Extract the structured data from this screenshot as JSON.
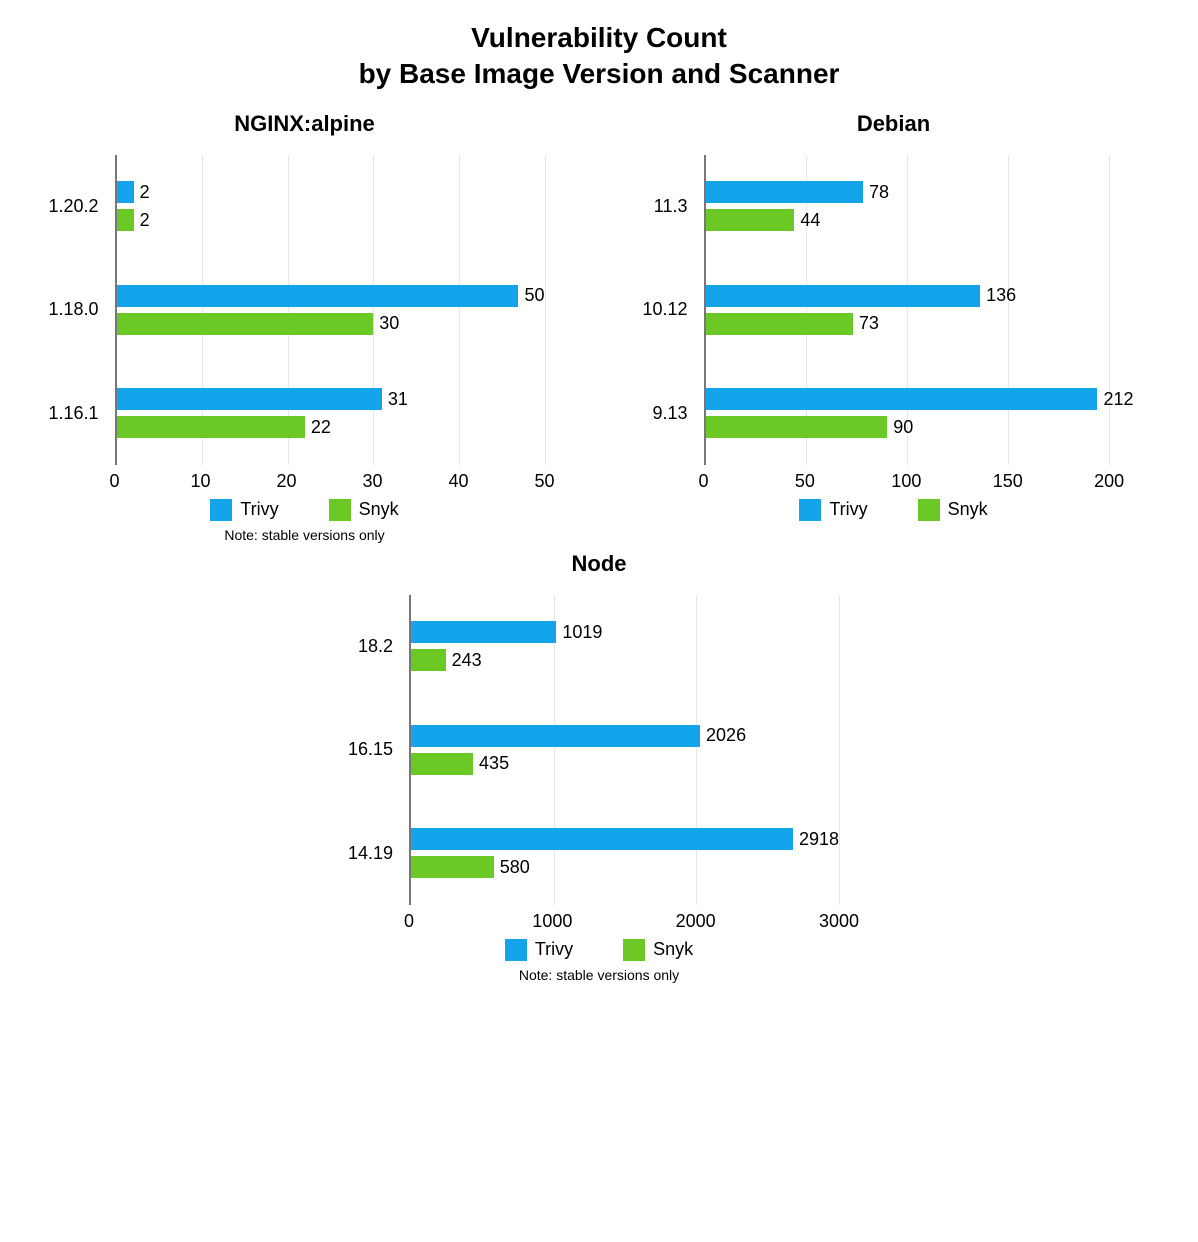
{
  "title_line1": "Vulnerability Count",
  "title_line2": "by Base Image Version and Scanner",
  "legend": {
    "trivy": "Trivy",
    "snyk": "Snyk"
  },
  "note": "Note: stable versions only",
  "colors": {
    "trivy": "#13a4ec",
    "snyk": "#6cc824"
  },
  "chart_data": [
    {
      "title": "NGINX:alpine",
      "type": "bar",
      "orientation": "horizontal",
      "categories": [
        "1.20.2",
        "1.18.0",
        "1.16.1"
      ],
      "series": [
        {
          "name": "Trivy",
          "values": [
            2,
            50,
            31
          ]
        },
        {
          "name": "Snyk",
          "values": [
            2,
            30,
            22
          ]
        }
      ],
      "xlim": [
        0,
        50
      ],
      "xticks": [
        0,
        10,
        20,
        30,
        40,
        50
      ],
      "note": true
    },
    {
      "title": "Debian",
      "type": "bar",
      "orientation": "horizontal",
      "categories": [
        "11.3",
        "10.12",
        "9.13"
      ],
      "series": [
        {
          "name": "Trivy",
          "values": [
            78,
            136,
            212
          ]
        },
        {
          "name": "Snyk",
          "values": [
            44,
            73,
            90
          ]
        }
      ],
      "xlim": [
        0,
        212
      ],
      "xticks": [
        0,
        50,
        100,
        150,
        200
      ],
      "note": false
    },
    {
      "title": "Node",
      "type": "bar",
      "orientation": "horizontal",
      "categories": [
        "18.2",
        "16.15",
        "14.19"
      ],
      "series": [
        {
          "name": "Trivy",
          "values": [
            1019,
            2026,
            2918
          ]
        },
        {
          "name": "Snyk",
          "values": [
            243,
            435,
            580
          ]
        }
      ],
      "xlim": [
        0,
        3000
      ],
      "xticks": [
        0,
        1000,
        2000,
        3000
      ],
      "note": true
    }
  ]
}
